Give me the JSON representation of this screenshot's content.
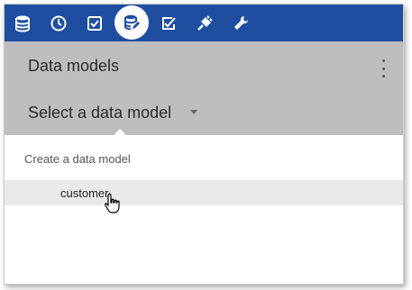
{
  "toolbar": {
    "background": "#1f4ea1",
    "items": [
      {
        "icon": "database-icon"
      },
      {
        "icon": "dashboard-gauge-icon"
      },
      {
        "icon": "checkbox-icon"
      },
      {
        "icon": "data-model-icon",
        "active": true
      },
      {
        "icon": "edit-check-icon"
      },
      {
        "icon": "plug-icon"
      },
      {
        "icon": "wrench-icon"
      }
    ]
  },
  "header": {
    "title": "Data models",
    "select_label": "Select a data model"
  },
  "dropdown": {
    "create_label": "Create a data model",
    "items": [
      "customer"
    ]
  }
}
